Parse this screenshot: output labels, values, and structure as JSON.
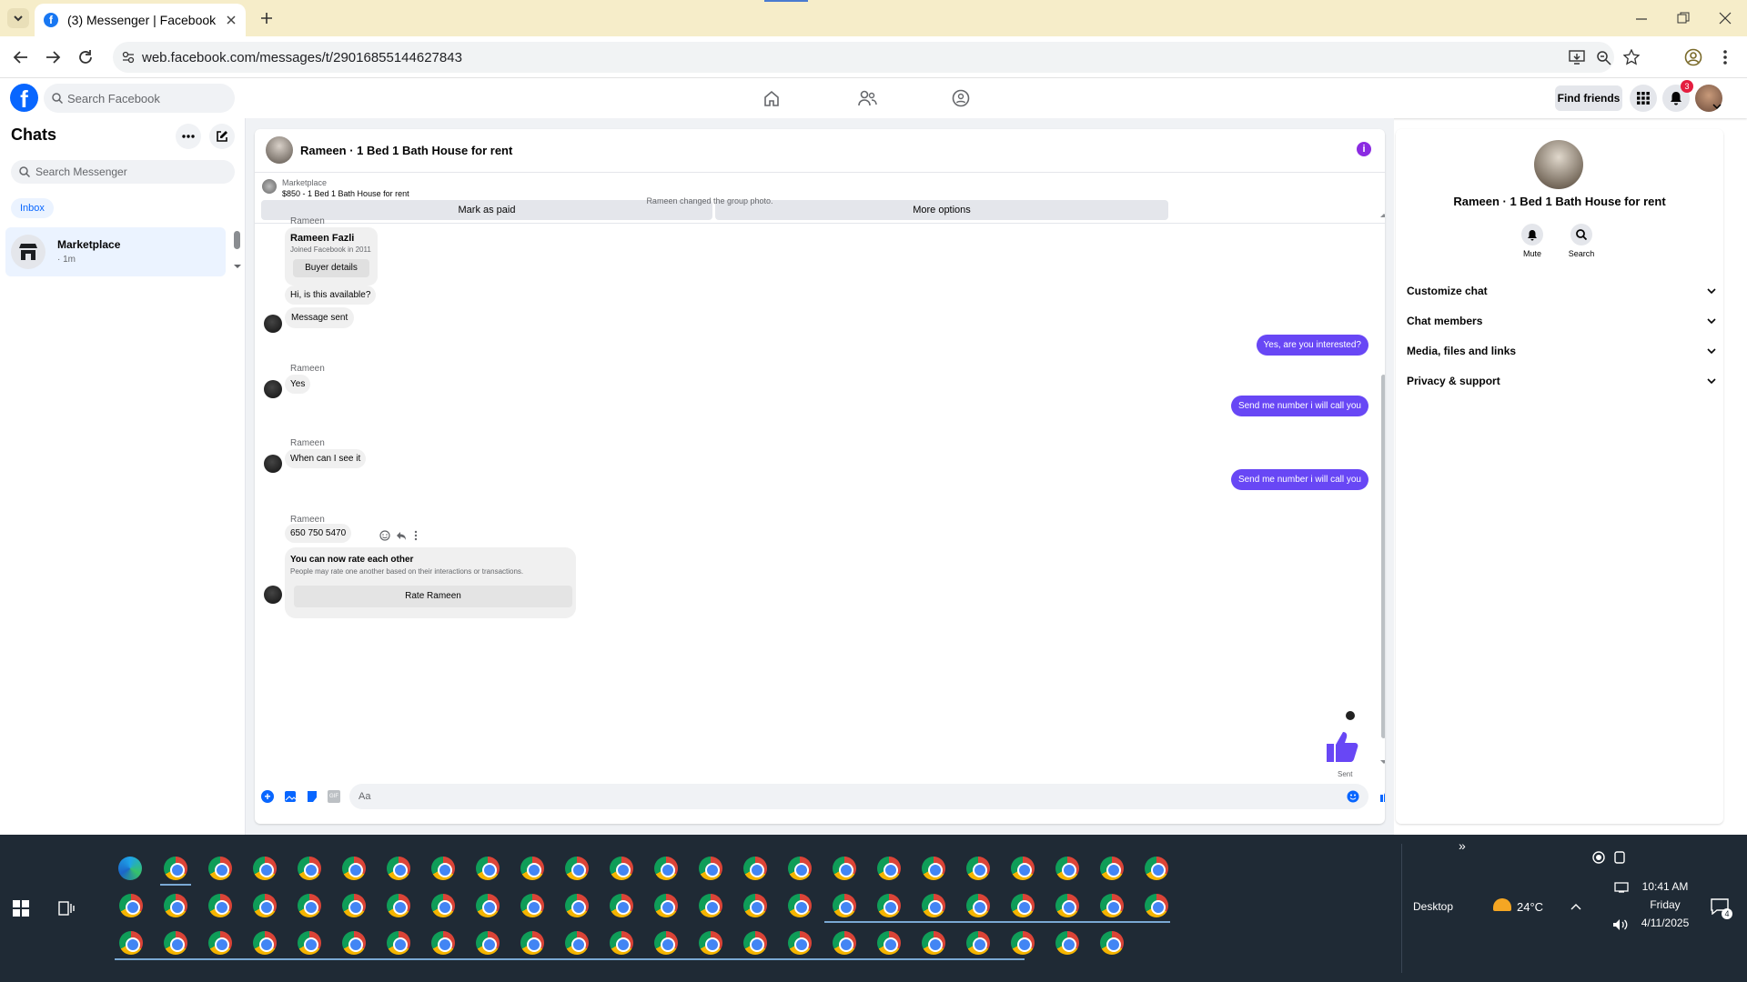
{
  "browser": {
    "tab_title": "(3) Messenger | Facebook",
    "url": "web.facebook.com/messages/t/29016855144627843"
  },
  "fb": {
    "search_placeholder": "Search Facebook",
    "find_friends": "Find friends",
    "notif_count": "3"
  },
  "left": {
    "title": "Chats",
    "search_placeholder": "Search Messenger",
    "inbox_label": "Inbox",
    "chat_name": "Marketplace",
    "chat_time": "· 1m"
  },
  "chat": {
    "title": "Rameen · 1 Bed 1 Bath House for rent",
    "listing_source": "Marketplace",
    "listing_line": "$850 - 1 Bed 1 Bath House for rent",
    "mark_paid": "Mark as paid",
    "more_options": "More options",
    "system_note": "Rameen changed the group photo.",
    "sender": "Rameen",
    "buyer_name": "Rameen Fazli",
    "buyer_joined": "Joined Facebook in 2011",
    "buyer_details": "Buyer details",
    "msg1": "Hi, is this available?",
    "msg2": "Message sent",
    "out1": "Yes, are you interested?",
    "msg3": "Yes",
    "out2": "Send me number i will call you",
    "msg4": "When can I see it",
    "out3": "Send me number i will call you",
    "msg5": "650 750 5470",
    "rate_title": "You can now rate each other",
    "rate_desc": "People may rate one another based on their interactions or transactions.",
    "rate_button": "Rate Rameen",
    "sent_label": "Sent",
    "composer_placeholder": "Aa",
    "accent": "#6847f5"
  },
  "info": {
    "name": "Rameen · 1 Bed 1 Bath House for rent",
    "mute": "Mute",
    "search": "Search",
    "rows": [
      "Customize chat",
      "Chat members",
      "Media, files and links",
      "Privacy & support"
    ]
  },
  "taskbar": {
    "desktop": "Desktop",
    "temp": "24°C",
    "time": "10:41 AM",
    "day": "Friday",
    "date": "4/11/2025",
    "notif": "4"
  }
}
